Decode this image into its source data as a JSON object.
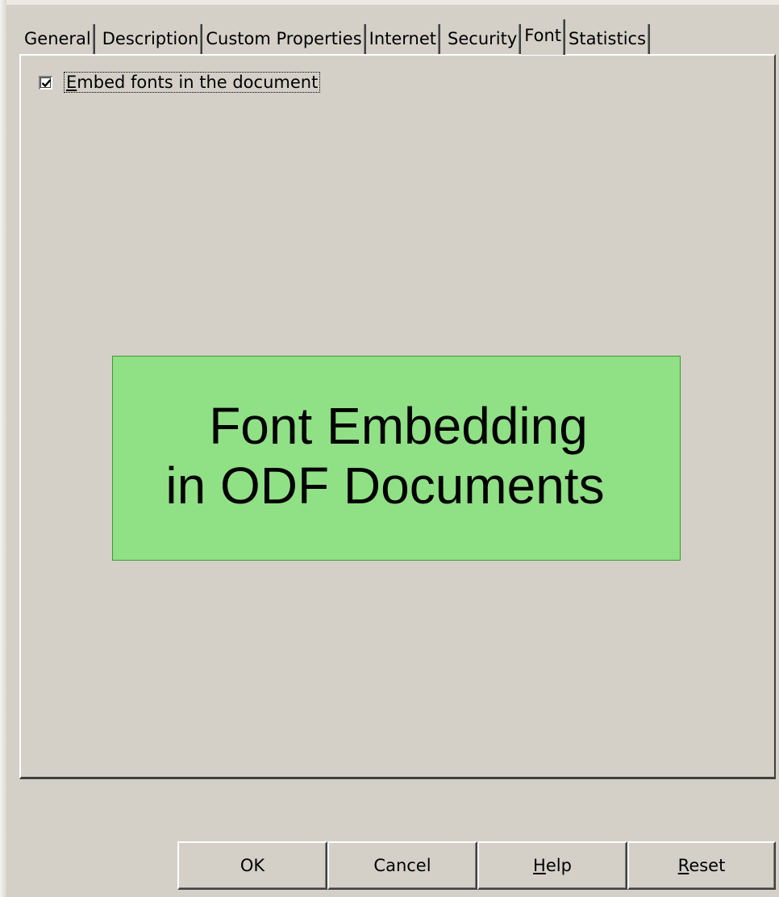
{
  "tabs": [
    {
      "label": "General",
      "active": false
    },
    {
      "label": "Description",
      "active": false
    },
    {
      "label": "Custom Properties",
      "active": false
    },
    {
      "label": "Internet",
      "active": false
    },
    {
      "label": "Security",
      "active": false
    },
    {
      "label": "Font",
      "active": true
    },
    {
      "label": "Statistics",
      "active": false
    }
  ],
  "font_tab": {
    "embed_checkbox": {
      "label": "Embed fonts in the document",
      "checked": true
    }
  },
  "overlay": {
    "line1": "Font Embedding",
    "line2": "in ODF Documents",
    "color": "#90e085"
  },
  "buttons": {
    "ok": "OK",
    "cancel": "Cancel",
    "help": "Help",
    "reset": "Reset"
  },
  "colors": {
    "dialog_background": "#d4d0c8",
    "overlay_background": "#90e085"
  },
  "icons": {
    "checkmark": "check-icon"
  }
}
